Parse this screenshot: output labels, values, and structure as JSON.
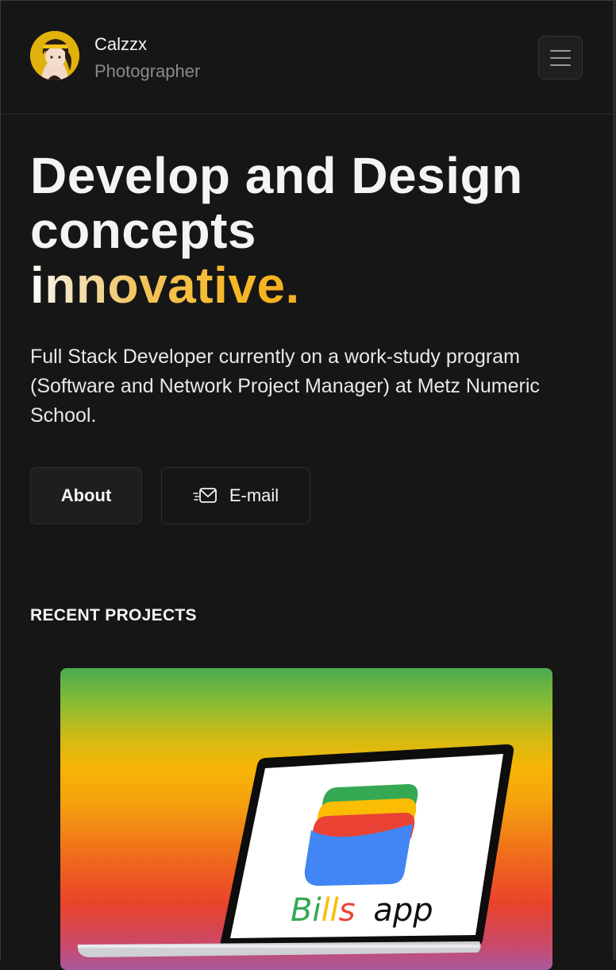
{
  "header": {
    "name": "Calzzx",
    "role": "Photographer"
  },
  "hero": {
    "title_line1": "Develop and Design",
    "title_line2": "concepts",
    "title_accent": "innovative.",
    "subtitle": "Full Stack Developer currently on a work-study program (Software and Network Project Manager) at Metz Numeric School."
  },
  "buttons": {
    "about": "About",
    "email": "E-mail"
  },
  "projects": {
    "section_title": "RECENT PROJECTS",
    "items": [
      {
        "title_part1": "Bi",
        "title_part2": "ll",
        "title_part3": "s",
        "title_part4": "app"
      }
    ]
  },
  "colors": {
    "background": "#161616",
    "accent": "#f4ad1c",
    "app_blue": "#4285f4",
    "app_red": "#ea4335",
    "app_yellow": "#fbbc04",
    "app_green": "#34a853"
  }
}
